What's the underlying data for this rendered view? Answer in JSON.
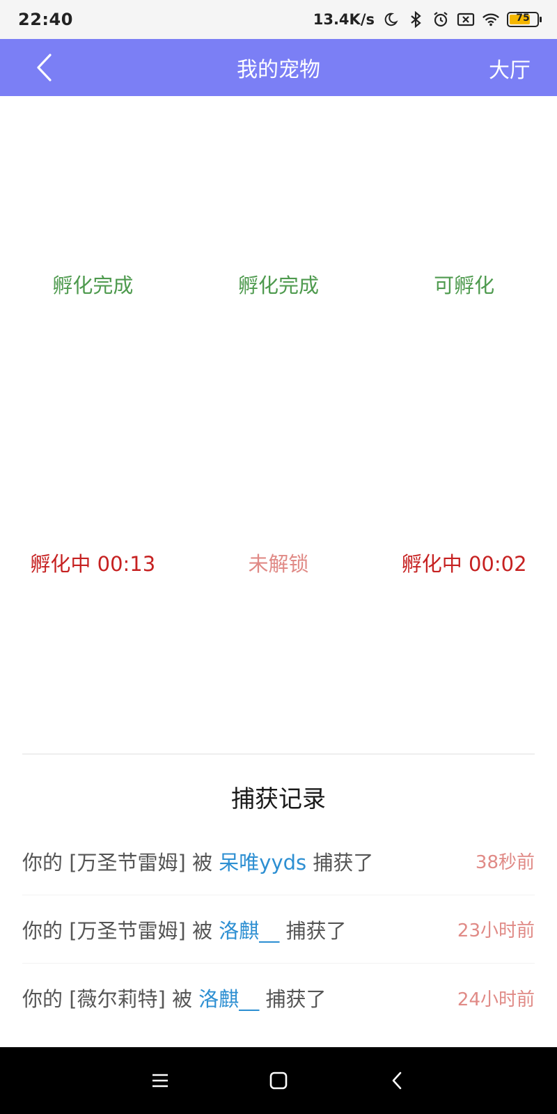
{
  "status_bar": {
    "time": "22:40",
    "net_speed": "13.4K/s",
    "battery_level": "75",
    "battery_fraction": 0.75,
    "icons": [
      "moon-icon",
      "bluetooth-icon",
      "alarm-icon",
      "sim-off-icon",
      "wifi-icon",
      "battery-icon"
    ]
  },
  "header": {
    "title": "我的宠物",
    "right_action": "大厅",
    "background": "#7b7ff5"
  },
  "pets": {
    "row1": [
      {
        "status": "孵化完成",
        "color": "#4e9a4e"
      },
      {
        "status": "孵化完成",
        "color": "#4e9a4e"
      },
      {
        "status": "可孵化",
        "color": "#4e9a4e"
      }
    ],
    "row2": [
      {
        "status": "孵化中 00:13",
        "color": "#c62121"
      },
      {
        "status": "未解锁",
        "color": "#e08a86"
      },
      {
        "status": "孵化中 00:02",
        "color": "#c62121"
      }
    ]
  },
  "records": {
    "title": "捕获记录",
    "items": [
      {
        "prefix": "你的 [万圣节雷姆] 被 ",
        "user": "呆唯yyds",
        "suffix": " 捕获了",
        "time": "38秒前"
      },
      {
        "prefix": "你的 [万圣节雷姆] 被 ",
        "user": "洛麒__",
        "suffix": " 捕获了",
        "time": "23小时前"
      },
      {
        "prefix": "你的 [薇尔莉特] 被 ",
        "user": "洛麒__",
        "suffix": " 捕获了",
        "time": "24小时前"
      }
    ]
  },
  "nav_bar": {
    "buttons": [
      "menu-icon",
      "home-icon",
      "back-icon"
    ]
  }
}
